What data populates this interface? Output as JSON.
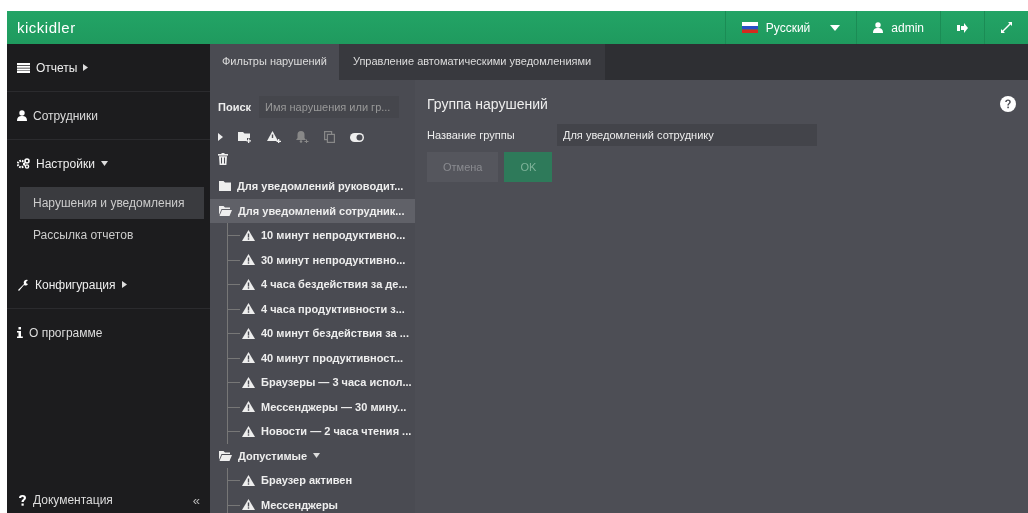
{
  "header": {
    "logo": "kickidler",
    "language": "Русский",
    "user": "admin"
  },
  "sidebar": {
    "items": [
      {
        "label": "Отчеты",
        "kind": "menu",
        "expanded": false,
        "selected": false
      },
      {
        "label": "Сотрудники",
        "kind": "link",
        "selected": false
      },
      {
        "label": "Настройки",
        "kind": "menu",
        "expanded": true,
        "selected": false,
        "children": [
          {
            "label": "Нарушения и уведомления",
            "selected": true
          },
          {
            "label": "Рассылка отчетов",
            "selected": false
          }
        ]
      },
      {
        "label": "Конфигурация",
        "kind": "menu",
        "expanded": false,
        "selected": false
      },
      {
        "label": "О программе",
        "kind": "link",
        "selected": false
      }
    ],
    "footer": {
      "label": "Документация",
      "collapse": "«"
    }
  },
  "tabs": [
    {
      "label": "Фильтры нарушений",
      "selected": true
    },
    {
      "label": "Управление автоматическими уведомлениями",
      "selected": false
    }
  ],
  "search": {
    "label": "Поиск",
    "placeholder": "Имя нарушения или гр..."
  },
  "tree": [
    {
      "label": "Для уведомлений руководит...",
      "expanded": false,
      "selected": false,
      "dropdown": false
    },
    {
      "label": "Для уведомлений сотрудник...",
      "expanded": true,
      "selected": true,
      "dropdown": false,
      "children": [
        {
          "label": "10 минут непродуктивно..."
        },
        {
          "label": "30 минут непродуктивно..."
        },
        {
          "label": "4 часа бездействия за де..."
        },
        {
          "label": "4 часа продуктивности з..."
        },
        {
          "label": "40 минут бездействия за ..."
        },
        {
          "label": "40 минут продуктивност..."
        },
        {
          "label": "Браузеры — 3 часа испол..."
        },
        {
          "label": "Мессенджеры — 30 мину..."
        },
        {
          "label": "Новости — 2 часа чтения ..."
        }
      ]
    },
    {
      "label": "Допустимые",
      "expanded": true,
      "selected": false,
      "dropdown": true,
      "children": [
        {
          "label": "Браузер активен"
        },
        {
          "label": "Мессенджеры"
        }
      ]
    }
  ],
  "form": {
    "title": "Группа нарушений",
    "field_label": "Название группы",
    "field_value": "Для уведомлений сотруднику",
    "buttons": [
      {
        "label": "Отмена",
        "kind": "cancel"
      },
      {
        "label": "OK",
        "kind": "ok"
      }
    ]
  }
}
